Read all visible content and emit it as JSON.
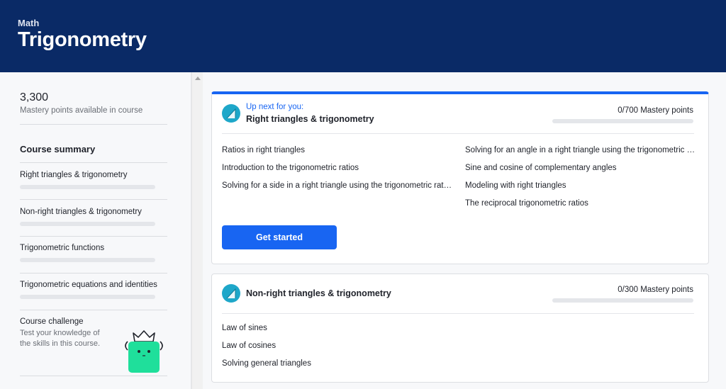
{
  "header": {
    "subject": "Math",
    "title": "Trigonometry"
  },
  "sidebar": {
    "mastery_total": "3,300",
    "mastery_caption": "Mastery points available in course",
    "summary_heading": "Course summary",
    "units": [
      {
        "label": "Right triangles & trigonometry",
        "progress": 0
      },
      {
        "label": "Non-right triangles & trigonometry",
        "progress": 0
      },
      {
        "label": "Trigonometric functions",
        "progress": 0
      },
      {
        "label": "Trigonometric equations and identities",
        "progress": 0
      }
    ],
    "challenge": {
      "title": "Course challenge",
      "description": "Test your knowledge of the skills in this course."
    }
  },
  "main": {
    "cards": [
      {
        "upnext": "Up next for you:",
        "title": "Right triangles & trigonometry",
        "points": "0/700 Mastery points",
        "progress": 0,
        "lessons_left": [
          "Ratios in right triangles",
          "Introduction to the trigonometric ratios",
          "Solving for a side in a right triangle using the trigonometric ratios"
        ],
        "lessons_right": [
          "Solving for an angle in a right triangle using the trigonometric ratios",
          "Sine and cosine of complementary angles",
          "Modeling with right triangles",
          "The reciprocal trigonometric ratios"
        ],
        "button": "Get started"
      },
      {
        "title": "Non-right triangles & trigonometry",
        "points": "0/300 Mastery points",
        "progress": 0,
        "lessons": [
          "Law of sines",
          "Law of cosines",
          "Solving general triangles"
        ]
      }
    ]
  },
  "colors": {
    "header_bg": "#0a2a66",
    "accent": "#1865f2",
    "unit_icon": "#1ea7c9",
    "mascot": "#1fdf9b"
  },
  "icons": [
    "unit-triangle-icon",
    "scroll-up-arrow-icon",
    "mascot-icon"
  ]
}
